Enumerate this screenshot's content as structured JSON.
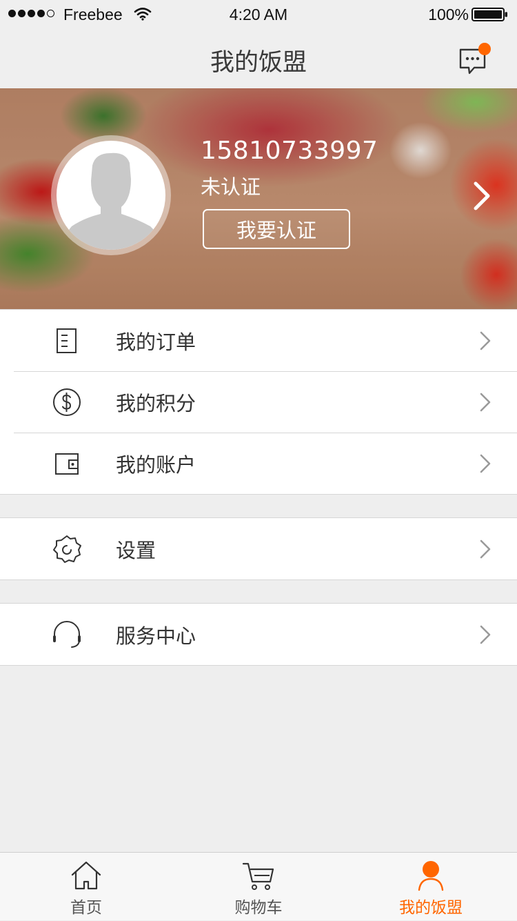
{
  "status_bar": {
    "carrier": "Freebee",
    "time": "4:20 AM",
    "battery": "100%",
    "signal_bars": 4,
    "signal_max": 5
  },
  "nav": {
    "title": "我的饭盟",
    "message_icon": "chat-bubble-icon",
    "has_unread": true
  },
  "profile": {
    "phone": "15810733997",
    "status": "未认证",
    "verify_button": "我要认证"
  },
  "menu_groups": [
    [
      {
        "label": "我的订单",
        "icon": "order-list-icon"
      },
      {
        "label": "我的积分",
        "icon": "dollar-coin-icon"
      },
      {
        "label": "我的账户",
        "icon": "wallet-icon"
      }
    ],
    [
      {
        "label": "设置",
        "icon": "gear-icon"
      }
    ],
    [
      {
        "label": "服务中心",
        "icon": "headset-icon"
      }
    ]
  ],
  "tabs": [
    {
      "label": "首页",
      "icon": "home-icon",
      "active": false
    },
    {
      "label": "购物车",
      "icon": "cart-icon",
      "active": false
    },
    {
      "label": "我的饭盟",
      "icon": "user-icon",
      "active": true
    }
  ],
  "colors": {
    "accent": "#ff6600",
    "background": "#eeeeee",
    "text": "#333333",
    "divider": "#d6d6d6"
  }
}
